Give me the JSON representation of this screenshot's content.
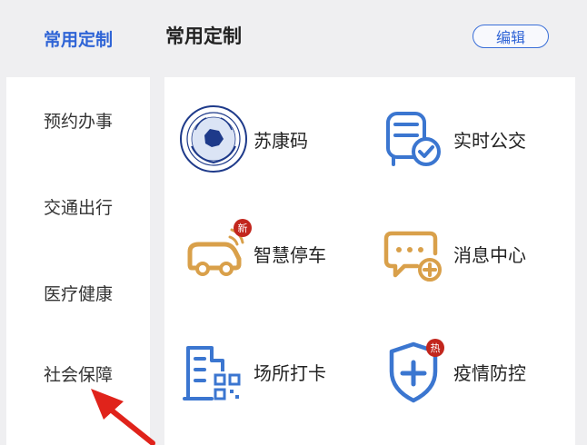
{
  "sidebar": {
    "items": [
      {
        "label": "常用定制",
        "active": true
      },
      {
        "label": "预约办事"
      },
      {
        "label": "交通出行"
      },
      {
        "label": "医疗健康"
      },
      {
        "label": "社会保障"
      }
    ]
  },
  "header": {
    "title": "常用定制",
    "edit_label": "编辑"
  },
  "services": [
    {
      "label": "苏康码",
      "icon": "emblem-icon"
    },
    {
      "label": "实时公交",
      "icon": "bus-check-icon"
    },
    {
      "label": "智慧停车",
      "icon": "car-icon",
      "badge": "新"
    },
    {
      "label": "消息中心",
      "icon": "message-plus-icon"
    },
    {
      "label": "场所打卡",
      "icon": "building-qr-icon"
    },
    {
      "label": "疫情防控",
      "icon": "shield-plus-icon",
      "badge": "热"
    }
  ],
  "colors": {
    "accent": "#2f64d6",
    "icon_blue": "#3b76d0",
    "icon_orange": "#d9a04a",
    "badge": "#c2261d"
  }
}
